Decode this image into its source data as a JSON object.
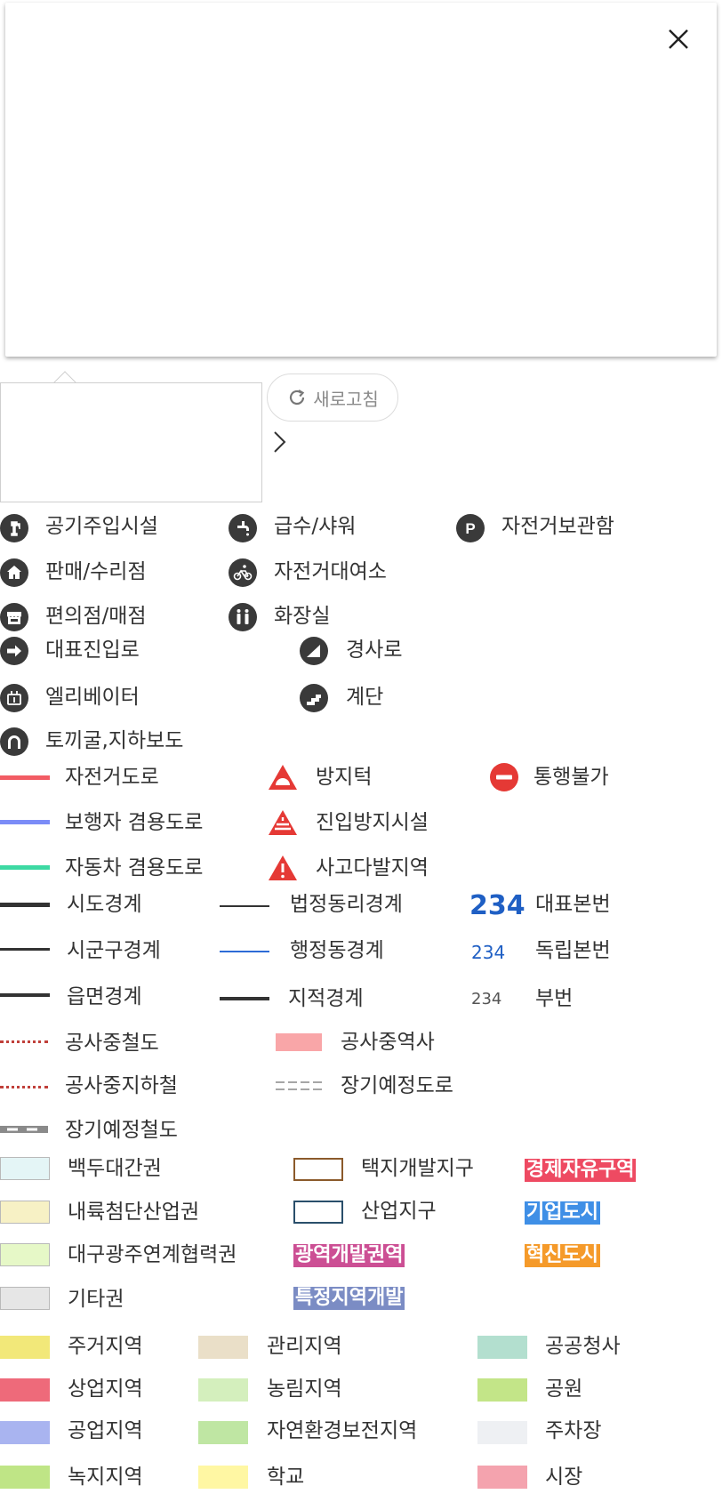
{
  "refresh": {
    "label": "새로고침"
  },
  "facilities": [
    {
      "label": "공기주입시설",
      "icon": "air-pump-icon"
    },
    {
      "label": "급수/샤워",
      "icon": "faucet-icon"
    },
    {
      "label": "자전거보관함",
      "icon": "parking-icon"
    },
    {
      "label": "판매/수리점",
      "icon": "shop-icon"
    },
    {
      "label": "자전거대여소",
      "icon": "bicycle-icon"
    },
    {
      "label": "편의점/매점",
      "icon": "store-icon"
    },
    {
      "label": "화장실",
      "icon": "restroom-icon"
    },
    {
      "label": "대표진입로",
      "icon": "arrow-right-icon"
    },
    {
      "label": "경사로",
      "icon": "slope-icon"
    },
    {
      "label": "엘리베이터",
      "icon": "elevator-icon"
    },
    {
      "label": "계단",
      "icon": "stairs-icon"
    },
    {
      "label": "토끼굴,지하보도",
      "icon": "tunnel-icon"
    }
  ],
  "roads": [
    {
      "label": "자전거도로",
      "color": "#f25c64"
    },
    {
      "label": "보행자 겸용도로",
      "color": "#7b8cf7"
    },
    {
      "label": "자동차 겸용도로",
      "color": "#3dd9a3"
    }
  ],
  "hazards": [
    {
      "label": "방지턱",
      "icon": "speed-bump-icon"
    },
    {
      "label": "진입방지시설",
      "icon": "barrier-icon"
    },
    {
      "label": "사고다발지역",
      "icon": "warning-icon"
    },
    {
      "label": "통행불가",
      "icon": "no-entry-icon"
    }
  ],
  "boundaries": [
    {
      "label": "시도경계"
    },
    {
      "label": "시군구경계"
    },
    {
      "label": "읍면경계"
    },
    {
      "label": "법정동리경계"
    },
    {
      "label": "행정동경계"
    },
    {
      "label": "지적경계"
    }
  ],
  "parcels": [
    {
      "num": "234",
      "label": "대표본번"
    },
    {
      "num": "234",
      "label": "독립본번"
    },
    {
      "num": "234",
      "label": "부번"
    }
  ],
  "construction": [
    {
      "label": "공사중철도"
    },
    {
      "label": "공사중지하철"
    },
    {
      "label": "장기예정철도"
    },
    {
      "label": "공사중역사"
    },
    {
      "label": "장기예정도로"
    }
  ],
  "zones": [
    {
      "label": "백두대간권",
      "fill": "#e4f5f6"
    },
    {
      "label": "내륙첨단산업권",
      "fill": "#f7f1c5"
    },
    {
      "label": "대구광주연계협력권",
      "fill": "#e6f8c7"
    },
    {
      "label": "기타권",
      "fill": "#e6e6e6"
    }
  ],
  "districts": [
    {
      "label": "택지개발지구",
      "border": "#8b5a2b"
    },
    {
      "label": "산업지구",
      "border": "#2a4f6b"
    }
  ],
  "badges": [
    {
      "label": "경제자유구역",
      "color": "#ee4a62"
    },
    {
      "label": "기업도시",
      "color": "#3f8fe6"
    },
    {
      "label": "광역개발권역",
      "color": "#cc4f94"
    },
    {
      "label": "혁신도시",
      "color": "#f59a2a"
    },
    {
      "label": "특정지역개발",
      "color": "#7b8cc4"
    }
  ],
  "landuse": [
    {
      "label": "주거지역",
      "fill": "#f2e879"
    },
    {
      "label": "상업지역",
      "fill": "#ee6a7a"
    },
    {
      "label": "공업지역",
      "fill": "#a9b4f0"
    },
    {
      "label": "녹지지역",
      "fill": "#bfe586"
    },
    {
      "label": "관리지역",
      "fill": "#eadfc8"
    },
    {
      "label": "농림지역",
      "fill": "#d4efbd"
    },
    {
      "label": "자연환경보전지역",
      "fill": "#bfe6a3"
    },
    {
      "label": "학교",
      "fill": "#fff7a3"
    },
    {
      "label": "공공청사",
      "fill": "#b3dfcf"
    },
    {
      "label": "공원",
      "fill": "#c3e588"
    },
    {
      "label": "주차장",
      "fill": "#eef0f3"
    },
    {
      "label": "시장",
      "fill": "#f4a3ae"
    }
  ]
}
